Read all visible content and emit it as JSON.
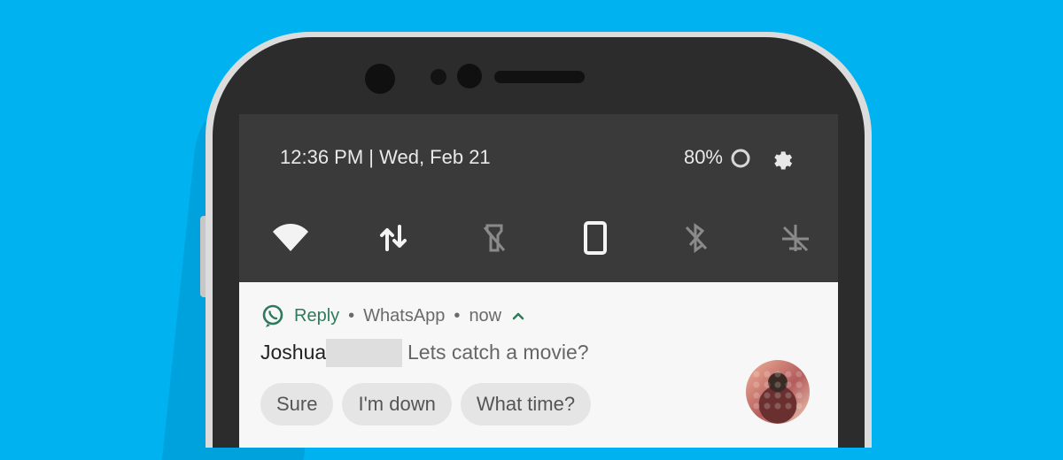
{
  "status": {
    "time_date": "12:36 PM | Wed, Feb 21",
    "battery": "80%"
  },
  "quick_settings": {
    "tiles": [
      "wifi-icon",
      "data-transfer-icon",
      "flashlight-off-icon",
      "portrait-icon",
      "bluetooth-off-icon",
      "airplane-off-icon"
    ]
  },
  "notification": {
    "app_label": "Reply",
    "source": "WhatsApp",
    "time": "now",
    "sender": "Joshua",
    "message": "Lets catch a movie?",
    "quick_replies": [
      "Sure",
      "I'm down",
      "What time?"
    ]
  },
  "colors": {
    "background": "#00b2f0",
    "accent": "#2f7a5c",
    "screen": "#3a3a3a"
  }
}
